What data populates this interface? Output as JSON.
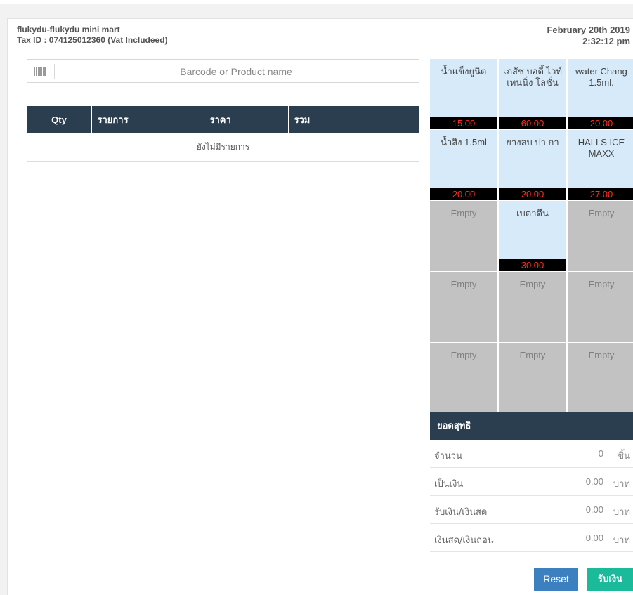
{
  "store": {
    "name": "flukydu-flukydu mini mart",
    "tax_id": "Tax ID : 074125012360 (Vat Includeed)",
    "date": "February 20th 2019",
    "time": "2:32:12 pm"
  },
  "search": {
    "placeholder": "Barcode or Product name",
    "icon": "barcode-icon"
  },
  "cart": {
    "columns": [
      "Qty",
      "รายการ",
      "ราคา",
      "รวม",
      ""
    ],
    "empty_message": "ยังไม่มีรายการ"
  },
  "products": [
    {
      "name": "น้ำแข็งยูนิต",
      "price": "15.00"
    },
    {
      "name": "เภสัช บอดี้ ไวท์เทนนิ่ง โลชั่น",
      "price": "60.00"
    },
    {
      "name": "water Chang 1.5ml.",
      "price": "20.00"
    },
    {
      "name": "น้ำสิง 1.5ml",
      "price": "20.00"
    },
    {
      "name": "ยางลบ ปา กา",
      "price": "20.00"
    },
    {
      "name": "HALLS ICE MAXX",
      "price": "27.00"
    },
    {
      "name": "Empty",
      "price": null
    },
    {
      "name": "เบตาดีน",
      "price": "30.00"
    },
    {
      "name": "Empty",
      "price": null
    },
    {
      "name": "Empty",
      "price": null
    },
    {
      "name": "Empty",
      "price": null
    },
    {
      "name": "Empty",
      "price": null
    },
    {
      "name": "Empty",
      "price": null
    },
    {
      "name": "Empty",
      "price": null
    },
    {
      "name": "Empty",
      "price": null
    }
  ],
  "summary": {
    "title": "ยอดสุทธิ",
    "rows": [
      {
        "label": "จำนวน",
        "value": "0",
        "unit": "ชิ้น"
      },
      {
        "label": "เป็นเงิน",
        "value": "0.00",
        "unit": "บาท"
      },
      {
        "label": "รับเงิน/เงินสด",
        "value": "0.00",
        "unit": "บาท"
      },
      {
        "label": "เงินสด/เงินถอน",
        "value": "0.00",
        "unit": "บาท"
      }
    ]
  },
  "buttons": {
    "reset": "Reset",
    "pay": "รับเงิน"
  },
  "colors": {
    "header_bg": "#2b3e50",
    "tile_filled": "#d6eaf9",
    "tile_empty": "#c2c2c2",
    "price_text": "#ff2d20",
    "reset_button": "#3c80c0",
    "pay_button": "#1bba9a"
  }
}
